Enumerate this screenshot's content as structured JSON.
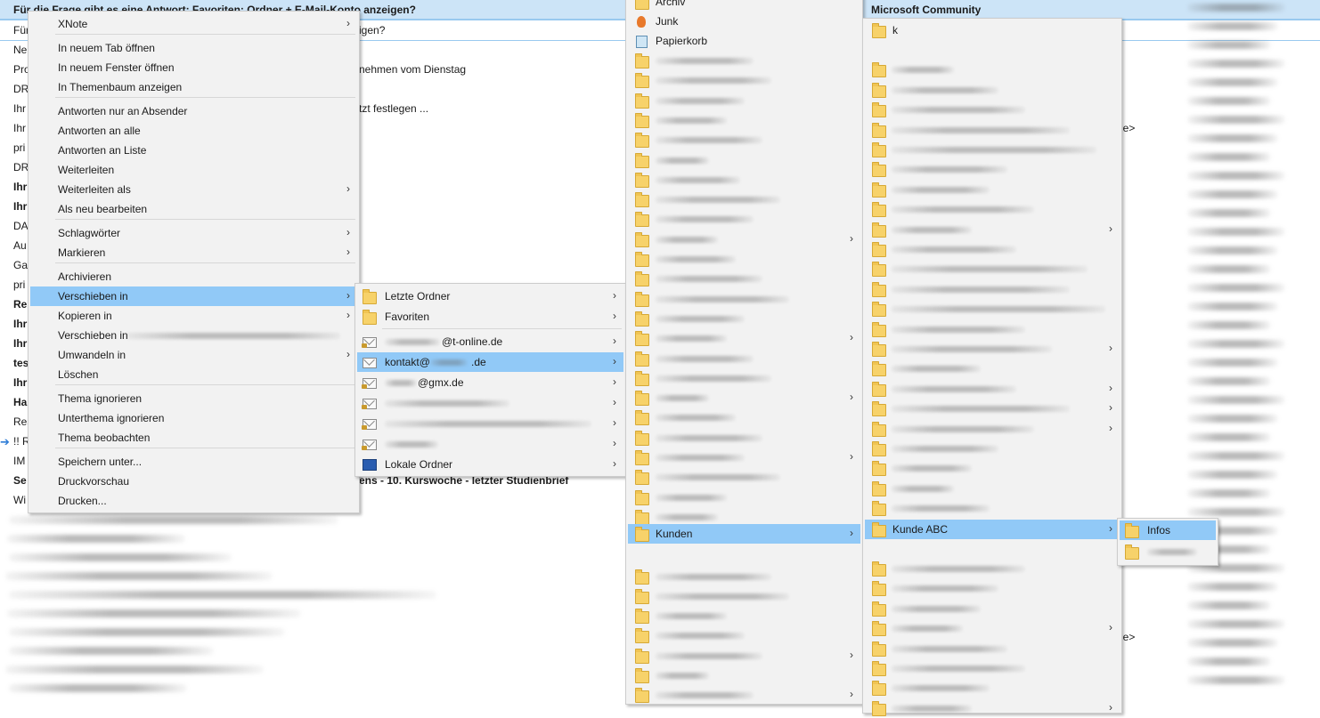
{
  "mail_list": {
    "header_subject": "Für die Frage gibt es eine Antwort: Favoriten: Ordner + E-Mail-Konto anzeigen?",
    "header_right": "Microsoft Community",
    "row_fragments": {
      "r1_tail": "igen?",
      "r3_tail": "nehmen vom Dienstag",
      "r5_tail": "tzt festlegen ...",
      "r_last_bold_tail": "ens - 10. Kurswoche - letzter Studienbrief",
      "right_tail_1": "le>",
      "right_tail_2": "le>"
    },
    "left_stubs": [
      "Für",
      "Ne",
      "Pro",
      "DR",
      "Ihr",
      "Ihr",
      "pri",
      "DR",
      "Ihr",
      "Ihr",
      "DA",
      "Au",
      "Ga",
      "pri",
      "Re",
      "Ihr",
      "Ihr",
      "tes",
      "Ihr",
      "Ha",
      "Res",
      "!! R",
      "IM",
      "Se",
      "Wi"
    ]
  },
  "context_menu": {
    "items": [
      {
        "label": "XNote",
        "sub": true
      },
      {
        "label": "In neuem Tab öffnen"
      },
      {
        "label": "In neuem Fenster öffnen"
      },
      {
        "label": "In Themenbaum anzeigen"
      },
      {
        "label": "Antworten nur an Absender"
      },
      {
        "label": "Antworten an alle"
      },
      {
        "label": "Antworten an Liste"
      },
      {
        "label": "Weiterleiten"
      },
      {
        "label": "Weiterleiten als",
        "sub": true
      },
      {
        "label": "Als neu bearbeiten"
      },
      {
        "label": "Schlagwörter",
        "sub": true
      },
      {
        "label": "Markieren",
        "sub": true
      },
      {
        "label": "Archivieren"
      },
      {
        "label": "Verschieben in",
        "sub": true
      },
      {
        "label": "Kopieren in",
        "sub": true
      },
      {
        "label": "Verschieben in"
      },
      {
        "label": "Umwandeln in",
        "sub": true
      },
      {
        "label": "Löschen"
      },
      {
        "label": "Thema ignorieren"
      },
      {
        "label": "Unterthema ignorieren"
      },
      {
        "label": "Thema beobachten"
      },
      {
        "label": "Speichern unter..."
      },
      {
        "label": "Druckvorschau"
      },
      {
        "label": "Drucken..."
      }
    ]
  },
  "move_submenu": {
    "items": [
      {
        "label": "Letzte Ordner"
      },
      {
        "label": "Favoriten"
      },
      {
        "label": "@t-online.de"
      },
      {
        "label": "kontakt@",
        "suffix": ".de"
      },
      {
        "label": "@gmx.de"
      },
      {
        "label": "Lokale Ordner"
      }
    ]
  },
  "account_folders": {
    "top": [
      "Archiv",
      "Junk",
      "Papierkorb"
    ],
    "kunden": "Kunden"
  },
  "kunden_submenu": {
    "first": "k",
    "kunde_abc": "Kunde ABC"
  },
  "kunde_abc_submenu": {
    "infos": "Infos"
  },
  "colors": {
    "highlight": "#91c9f7",
    "menu_bg": "#f2f2f2",
    "header_bg": "#cce4f7",
    "folder": "#f7d26a"
  }
}
